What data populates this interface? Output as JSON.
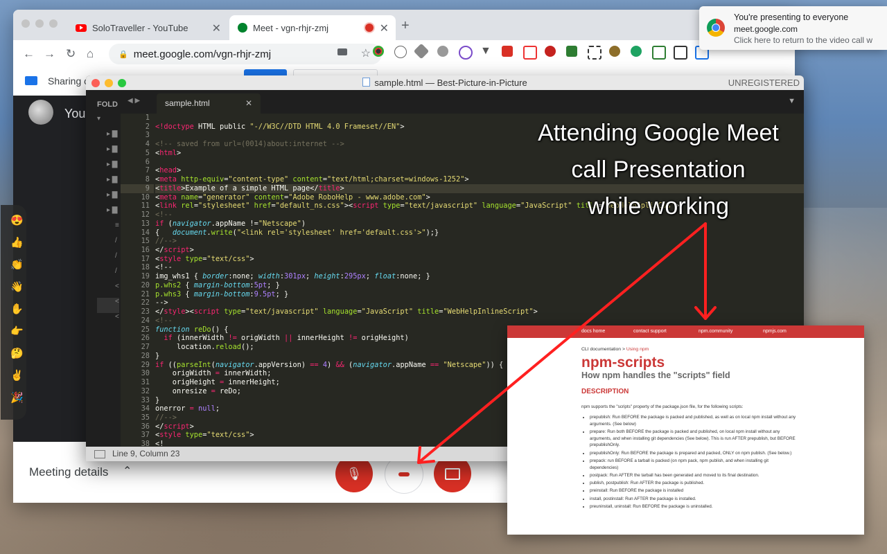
{
  "browser": {
    "tabs": [
      {
        "title": "SoloTraveller - YouTube",
        "icon": "youtube-icon"
      },
      {
        "title": "Meet - vgn-rhjr-zmj",
        "icon": "meet-icon"
      }
    ],
    "url": "meet.google.com/vgn-rhjr-zmj"
  },
  "meet": {
    "sharing_label": "Sharing c",
    "you_label": "You",
    "meeting_details": "Meeting details"
  },
  "notification": {
    "title": "You're presenting to everyone",
    "source": "meet.google.com",
    "body": "Click here to return to the video call w"
  },
  "sublime": {
    "title": "sample.html — Best-Picture-in-Picture",
    "unregistered": "UNREGISTERED",
    "sidebar_header": "FOLD",
    "tab": "sample.html",
    "status": "Line 9, Column 23",
    "lines": [
      "1",
      "2",
      "3",
      "4",
      "5",
      "6",
      "7",
      "8",
      "9",
      "10",
      "11",
      "12",
      "13",
      "14",
      "15",
      "16",
      "17",
      "18",
      "19",
      "20",
      "21",
      "22",
      "23",
      "24",
      "25",
      "26",
      "27",
      "28",
      "29",
      "30",
      "31",
      "32",
      "33",
      "34",
      "35",
      "36",
      "37",
      "38"
    ]
  },
  "overlay": {
    "line1": "Attending Google Meet",
    "line2": "call Presentation",
    "line3": "while working"
  },
  "npm": {
    "nav": [
      "docs home",
      "contact support",
      "npm.community",
      "npmjs.com"
    ],
    "breadcrumb_prefix": "CLI documentation > ",
    "breadcrumb_link": "Using npm",
    "title": "npm-scripts",
    "subtitle": "How npm handles the \"scripts\" field",
    "section": "DESCRIPTION",
    "intro": "npm supports the \"scripts\" property of the package.json file, for the following scripts:",
    "items": [
      "prepublish: Run BEFORE the package is packed and published, as well as on local npm install without any arguments. (See below)",
      "prepare: Run both BEFORE the package is packed and published, on local npm install without any arguments, and when installing git dependencies (See below). This is run AFTER prepublish, but BEFORE prepublishOnly.",
      "prepublishOnly: Run BEFORE the package is prepared and packed, ONLY on npm publish. (See below.)",
      "prepack: run BEFORE a tarball is packed (on npm pack, npm publish, and when installing git dependencies)",
      "postpack: Run AFTER the tarball has been generated and moved to its final destination.",
      "publish, postpublish: Run AFTER the package is published.",
      "preinstall: Run BEFORE the package is installed",
      "install, postinstall: Run AFTER the package is installed.",
      "preuninstall, uninstall: Run BEFORE the package is uninstalled."
    ]
  },
  "colors": {
    "accent": "#d93025",
    "npm_red": "#cb3837",
    "arrow": "#ff2020"
  }
}
